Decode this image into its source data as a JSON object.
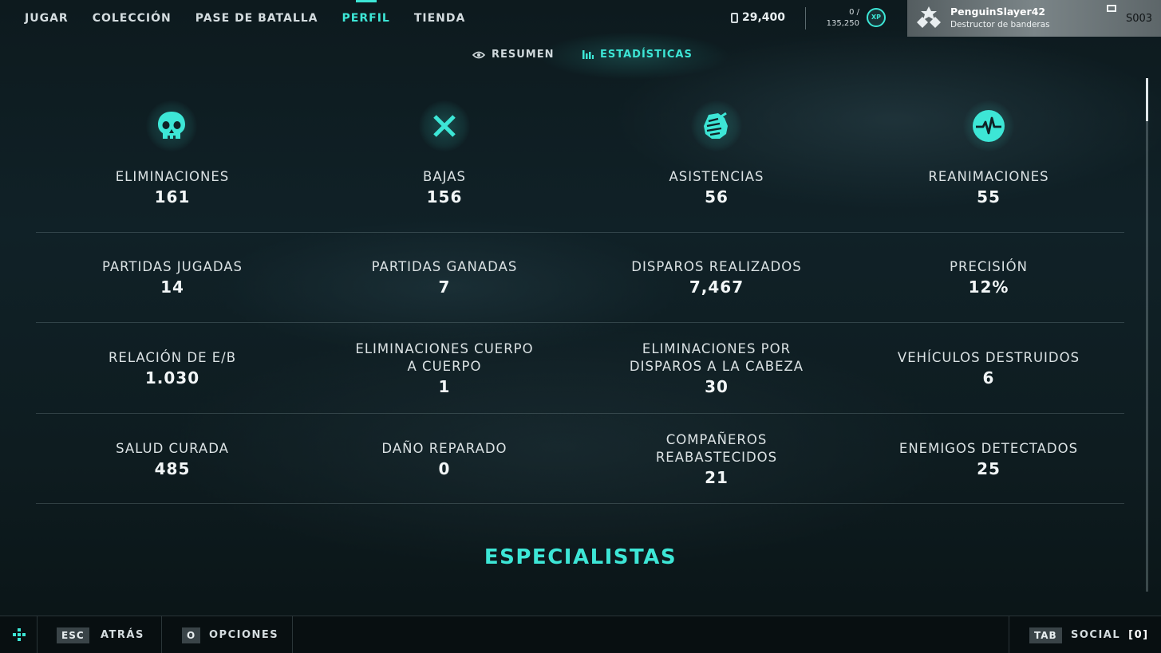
{
  "nav": {
    "items": [
      {
        "label": "JUGAR"
      },
      {
        "label": "COLECCIÓN"
      },
      {
        "label": "PASE DE BATALLA"
      },
      {
        "label": "PERFIL"
      },
      {
        "label": "TIENDA"
      }
    ],
    "active": "PERFIL"
  },
  "currency": {
    "amount": "29,400"
  },
  "xp": {
    "current": "0 /",
    "total": "135,250",
    "badge": "XP"
  },
  "profile": {
    "username": "PenguinSlayer42",
    "title": "Destructor de banderas",
    "season": "S003"
  },
  "subtabs": [
    {
      "label": "RESUMEN",
      "icon": "eye-icon"
    },
    {
      "label": "ESTADÍSTICAS",
      "icon": "bar-chart-icon",
      "active": true
    }
  ],
  "stats": [
    [
      {
        "label": "ELIMINACIONES",
        "value": "161",
        "icon": "skull-icon"
      },
      {
        "label": "BAJAS",
        "value": "156",
        "icon": "x-icon"
      },
      {
        "label": "ASISTENCIAS",
        "value": "56",
        "icon": "handshake-icon"
      },
      {
        "label": "REANIMACIONES",
        "value": "55",
        "icon": "heartbeat-icon"
      }
    ],
    [
      {
        "label": "PARTIDAS JUGADAS",
        "value": "14"
      },
      {
        "label": "PARTIDAS GANADAS",
        "value": "7"
      },
      {
        "label": "DISPAROS REALIZADOS",
        "value": "7,467"
      },
      {
        "label": "PRECISIÓN",
        "value": "12%"
      }
    ],
    [
      {
        "label": "RELACIÓN DE E/B",
        "value": "1.030"
      },
      {
        "label": "ELIMINACIONES CUERPO A CUERPO",
        "value": "1"
      },
      {
        "label": "ELIMINACIONES POR DISPAROS A LA CABEZA",
        "value": "30"
      },
      {
        "label": "VEHÍCULOS DESTRUIDOS",
        "value": "6"
      }
    ],
    [
      {
        "label": "SALUD CURADA",
        "value": "485"
      },
      {
        "label": "DAÑO REPARADO",
        "value": "0"
      },
      {
        "label": "COMPAÑEROS REABASTECIDOS",
        "value": "21"
      },
      {
        "label": "ENEMIGOS DETECTADOS",
        "value": "25"
      }
    ]
  ],
  "section": {
    "title": "ESPECIALISTAS"
  },
  "bottom": {
    "back": {
      "key": "ESC",
      "label": "ATRÁS"
    },
    "options": {
      "key": "O",
      "label": "OPCIONES"
    },
    "social": {
      "key": "TAB",
      "label": "SOCIAL",
      "count": "[0]"
    }
  },
  "colors": {
    "accent": "#3de6d6",
    "background": "#0f1e22",
    "text": "#e8eef0"
  }
}
